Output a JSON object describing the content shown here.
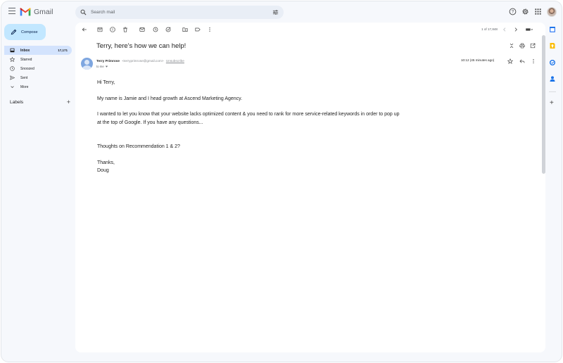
{
  "app": {
    "name": "Gmail"
  },
  "search": {
    "placeholder": "Search mail"
  },
  "compose": {
    "label": "Compose"
  },
  "sidebar": {
    "items": [
      {
        "label": "Inbox",
        "count": "17,171",
        "icon": "inbox-icon",
        "active": true
      },
      {
        "label": "Starred",
        "icon": "star-icon"
      },
      {
        "label": "Snoozed",
        "icon": "clock-icon"
      },
      {
        "label": "Sent",
        "icon": "send-icon"
      },
      {
        "label": "More",
        "icon": "chevron-down-icon"
      }
    ],
    "labels_title": "Labels",
    "labels_add": "+"
  },
  "toolbar": {
    "pager": "1 of 17,848",
    "icons": [
      "back-arrow-icon",
      "archive-icon",
      "report-spam-icon",
      "delete-icon",
      "mark-unread-icon",
      "snooze-icon",
      "add-task-icon",
      "move-to-icon",
      "label-icon",
      "more-vert-icon",
      "prev-icon",
      "next-icon",
      "input-tools-icon"
    ]
  },
  "email": {
    "subject": "Terry, here's how we can help!",
    "sender_name": "Terry Primrose",
    "sender_email": "<terryprimrose@gmail.com>",
    "unsubscribe": "Unsubscribe",
    "to": "to me",
    "time": "10:12 (45 minutes ago)",
    "body": [
      "Hi Terry,",
      "My name is Jamie and I head growth at Ascend Marketing Agency.",
      "I wanted to let you know that your website lacks optimized content & you need to rank for more service-related keywords in order to pop up at the top of Google. If you have any questions...",
      "Thoughts on Recommendation 1 & 2?",
      "Thanks,",
      "Doug"
    ]
  },
  "colors": {
    "background": "#f6f8fc",
    "compose_bg": "#c2e7ff",
    "active_nav": "#d3e3fd",
    "search_bg": "#e9eef6",
    "gmail_red": "#ea4335",
    "gmail_blue": "#4285f4",
    "gmail_green": "#34a853",
    "gmail_yellow": "#fbbc04"
  }
}
